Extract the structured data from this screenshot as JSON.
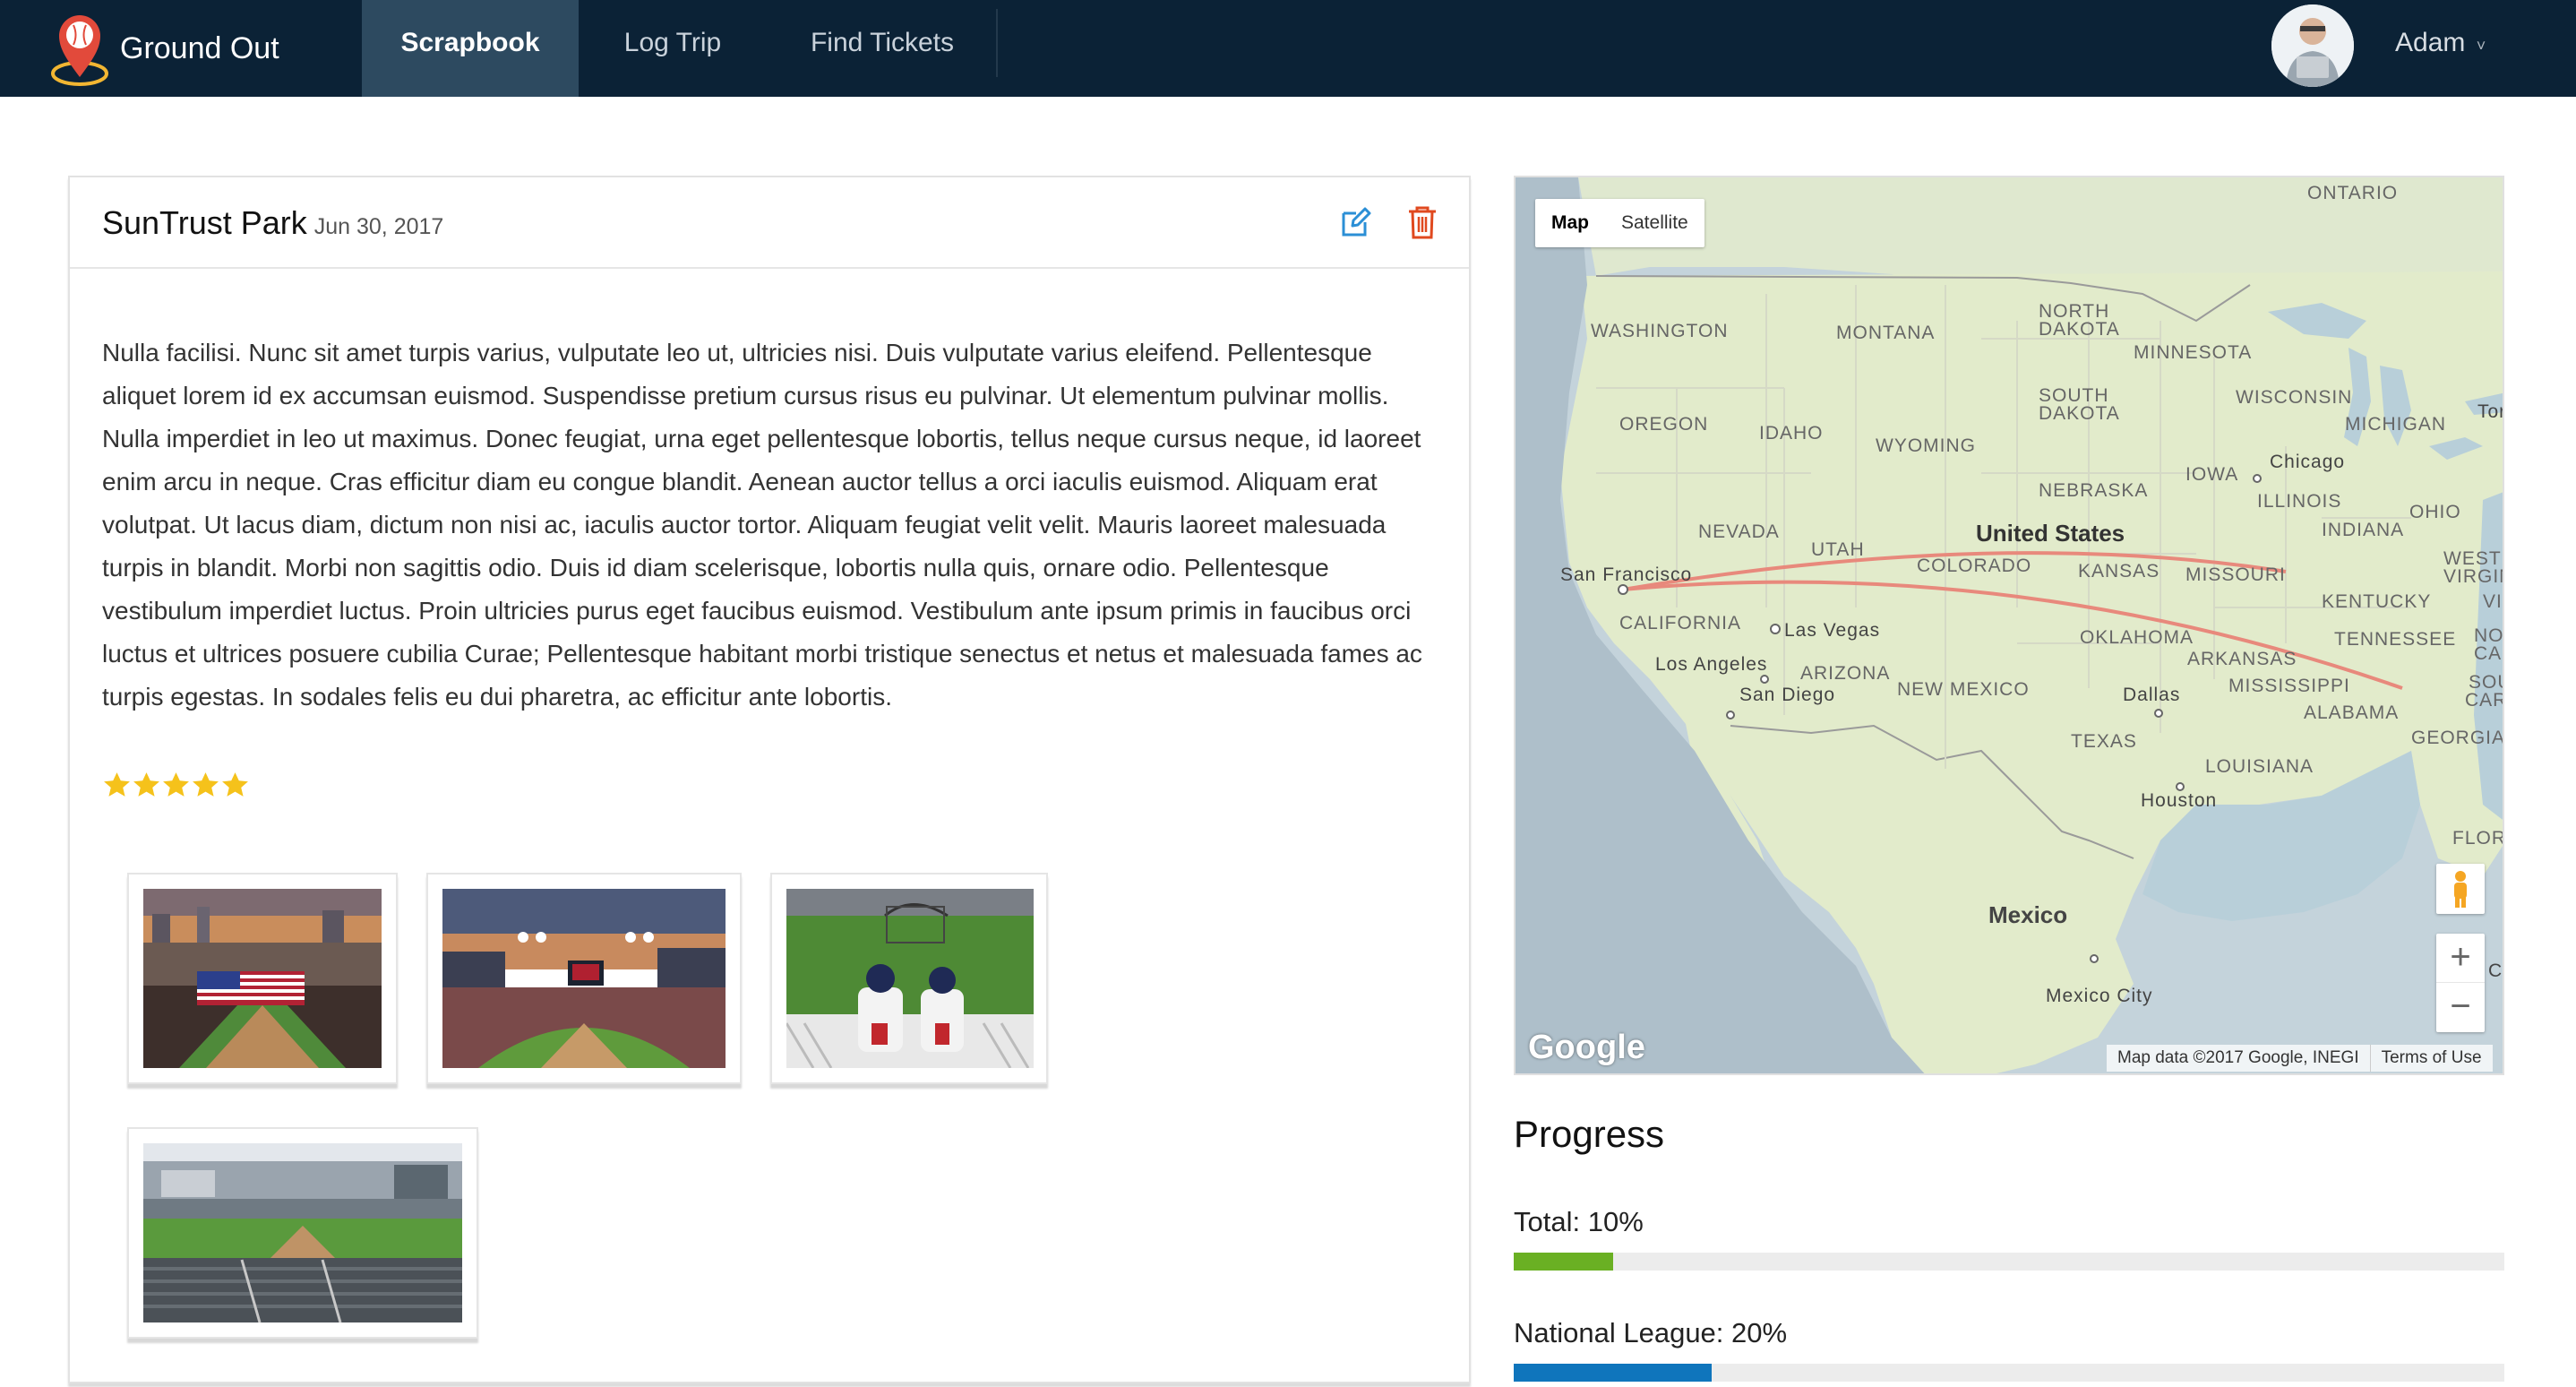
{
  "nav": {
    "brand": "Ground Out",
    "items": [
      {
        "label": "Scrapbook",
        "active": true
      },
      {
        "label": "Log Trip",
        "active": false
      },
      {
        "label": "Find Tickets",
        "active": false
      }
    ],
    "user": "Adam",
    "user_caret": "˅"
  },
  "entry": {
    "title": "SunTrust Park",
    "date": "Jun 30, 2017",
    "body": "Nulla facilisi. Nunc sit amet turpis varius, vulputate leo ut, ultricies nisi. Duis vulputate varius eleifend. Pellentesque aliquet lorem id ex accumsan euismod. Suspendisse pretium cursus risus eu pulvinar. Ut elementum pulvinar mollis. Nulla imperdiet in leo ut maximus. Donec feugiat, urna eget pellentesque lobortis, tellus neque cursus neque, id laoreet enim arcu in neque. Cras efficitur diam eu congue blandit. Aenean auctor tellus a orci iaculis euismod. Aliquam erat volutpat. Ut lacus diam, dictum non nisi ac, iaculis auctor tortor. Aliquam feugiat velit velit. Mauris laoreet malesuada turpis in blandit. Morbi non sagittis odio. Duis id diam scelerisque, lobortis nulla quis, ornare odio. Pellentesque vestibulum imperdiet luctus. Proin ultricies purus eget faucibus euismod. Vestibulum ante ipsum primis in faucibus orci luctus et ultrices posuere cubilia Curae; Pellentesque habitant morbi tristique senectus et netus et malesuada fames ac turpis egestas. In sodales felis eu dui pharetra, ac efficitur ante lobortis.",
    "rating": 5,
    "rating_max": 5
  },
  "map": {
    "type_map": "Map",
    "type_satellite": "Satellite",
    "zoom_in": "+",
    "zoom_out": "−",
    "logo": "Google",
    "attribution": "Map data ©2017 Google, INEGI",
    "terms": "Terms of Use",
    "labels": {
      "ontario": "ONTARIO",
      "washington": "WASHINGTON",
      "montana": "MONTANA",
      "north_dakota_1": "NORTH",
      "north_dakota_2": "DAKOTA",
      "minnesota": "MINNESOTA",
      "south_dakota_1": "SOUTH",
      "south_dakota_2": "DAKOTA",
      "wisconsin": "WISCONSIN",
      "michigan": "MICHIGAN",
      "toronto": "Toro",
      "oregon": "OREGON",
      "idaho": "IDAHO",
      "wyoming": "WYOMING",
      "chicago": "Chicago",
      "iowa": "IOWA",
      "nebraska": "NEBRASKA",
      "illinois": "ILLINOIS",
      "ohio": "OHIO",
      "indiana": "INDIANA",
      "nevada": "NEVADA",
      "utah": "UTAH",
      "united_states": "United States",
      "west_virginia_1": "WEST",
      "west_virginia_2": "VIRGINI",
      "san_francisco": "San Francisco",
      "colorado": "COLORADO",
      "kansas": "KANSAS",
      "missouri": "MISSOURI",
      "virginia": "VIRG",
      "kentucky": "KENTUCKY",
      "california": "CALIFORNIA",
      "las_vegas": "Las Vegas",
      "north_carolina_1": "NO",
      "north_carolina_2": "CARO",
      "tennessee": "TENNESSEE",
      "oklahoma": "OKLAHOMA",
      "los_angeles": "Los Angeles",
      "arizona": "ARIZONA",
      "arkansas": "ARKANSAS",
      "south_carolina_1": "SOUTH",
      "south_carolina_2": "CAROLI",
      "san_diego": "San Diego",
      "new_mexico": "NEW MEXICO",
      "mississippi": "MISSISSIPPI",
      "dallas": "Dallas",
      "alabama": "ALABAMA",
      "georgia": "GEORGIA",
      "texas": "TEXAS",
      "louisiana": "LOUISIANA",
      "houston": "Houston",
      "florida": "FLORIDA",
      "mexico": "Mexico",
      "mexico_city": "Mexico City",
      "cuba": "Cu"
    }
  },
  "progress": {
    "title": "Progress",
    "bars": [
      {
        "label": "Total: 10%",
        "value": 0.1,
        "color": "#6ab023"
      },
      {
        "label": "National League: 20%",
        "value": 0.2,
        "color": "#0f75bc"
      }
    ]
  },
  "colors": {
    "navbar": "#0b2236",
    "nav_active": "#2d4a60",
    "edit": "#2b8fd6",
    "delete": "#e0491f",
    "star": "#f5c21b",
    "route": "#e8897c"
  }
}
